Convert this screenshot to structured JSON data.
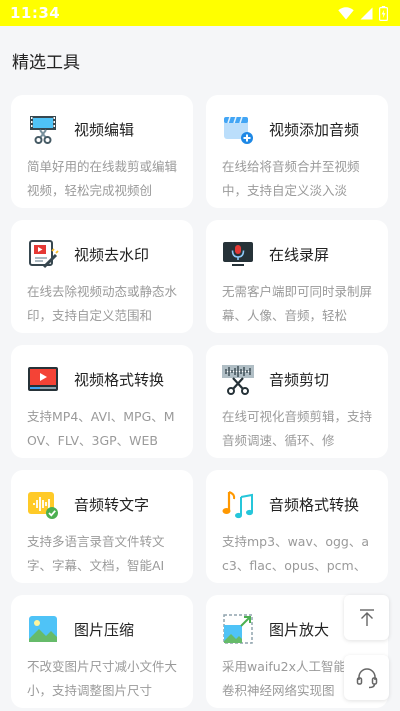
{
  "status": {
    "time": "11:34"
  },
  "section": {
    "title": "精选工具"
  },
  "tools": [
    {
      "title": "视频编辑",
      "desc": "简单好用的在线裁剪或编辑视频，轻松完成视频创",
      "icon": "film-scissors-icon"
    },
    {
      "title": "视频添加音频",
      "desc": "在线给将音频合并至视频中，支持自定义淡入淡",
      "icon": "video-add-audio-icon"
    },
    {
      "title": "视频去水印",
      "desc": "在线去除视频动态或静态水印，支持自定义范围和",
      "icon": "video-watermark-remove-icon"
    },
    {
      "title": "在线录屏",
      "desc": "无需客户端即可同时录制屏幕、人像、音频，轻松",
      "icon": "screen-record-mic-icon"
    },
    {
      "title": "视频格式转换",
      "desc": "支持MP4、AVI、MPG、MOV、FLV、3GP、WEB",
      "icon": "video-player-icon"
    },
    {
      "title": "音频剪切",
      "desc": "在线可视化音频剪辑，支持音频调速、循环、修",
      "icon": "audio-scissors-icon"
    },
    {
      "title": "音频转文字",
      "desc": "支持多语言录音文件转文字、字幕、文档，智能AI",
      "icon": "audio-to-text-icon"
    },
    {
      "title": "音频格式转换",
      "desc": "支持mp3、wav、ogg、ac3、flac、opus、pcm、",
      "icon": "music-notes-icon"
    },
    {
      "title": "图片压缩",
      "desc": "不改变图片尺寸减小文件大小，支持调整图片尺寸",
      "icon": "image-compress-icon"
    },
    {
      "title": "图片放大",
      "desc": "采用waifu2x人工智能深度卷积神经网络实现图",
      "icon": "image-enlarge-icon"
    }
  ],
  "floating": {
    "top_icon": "back-to-top-icon",
    "service_icon": "headset-icon"
  },
  "colors": {
    "status_bar": "#ffff00",
    "background": "#f5f6f8",
    "card": "#ffffff",
    "desc_text": "#9a9a9a"
  }
}
